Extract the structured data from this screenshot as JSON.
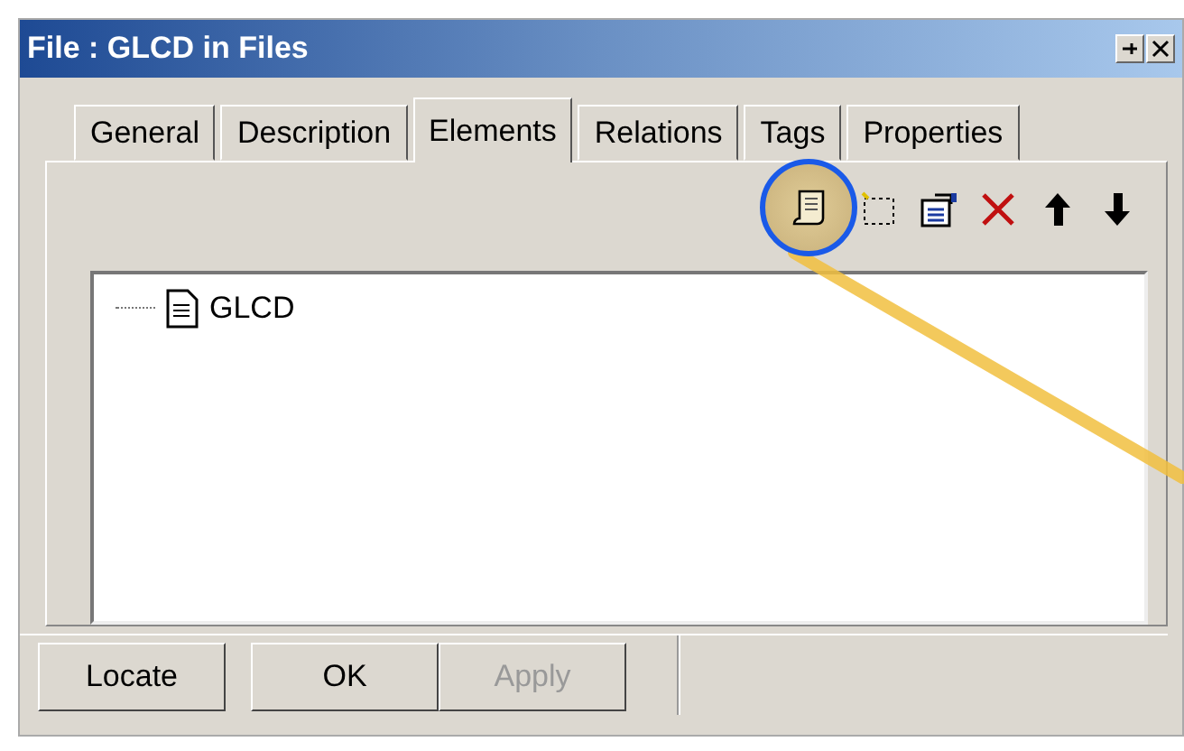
{
  "window": {
    "title": "File : GLCD in Files"
  },
  "tabs": [
    {
      "label": "General",
      "selected": false
    },
    {
      "label": "Description",
      "selected": false
    },
    {
      "label": "Elements",
      "selected": true
    },
    {
      "label": "Relations",
      "selected": false
    },
    {
      "label": "Tags",
      "selected": false
    },
    {
      "label": "Properties",
      "selected": false
    }
  ],
  "toolbar": [
    {
      "kind": "scroll",
      "highlighted": true
    },
    {
      "kind": "new",
      "highlighted": false
    },
    {
      "kind": "properties",
      "highlighted": false
    },
    {
      "kind": "delete",
      "highlighted": false
    },
    {
      "kind": "up",
      "highlighted": false
    },
    {
      "kind": "down",
      "highlighted": false
    }
  ],
  "tree": {
    "items": [
      {
        "label": "GLCD"
      }
    ]
  },
  "buttons": [
    {
      "label": "Locate",
      "disabled": false
    },
    {
      "label": "OK",
      "disabled": false
    },
    {
      "label": "Apply",
      "disabled": true
    }
  ]
}
